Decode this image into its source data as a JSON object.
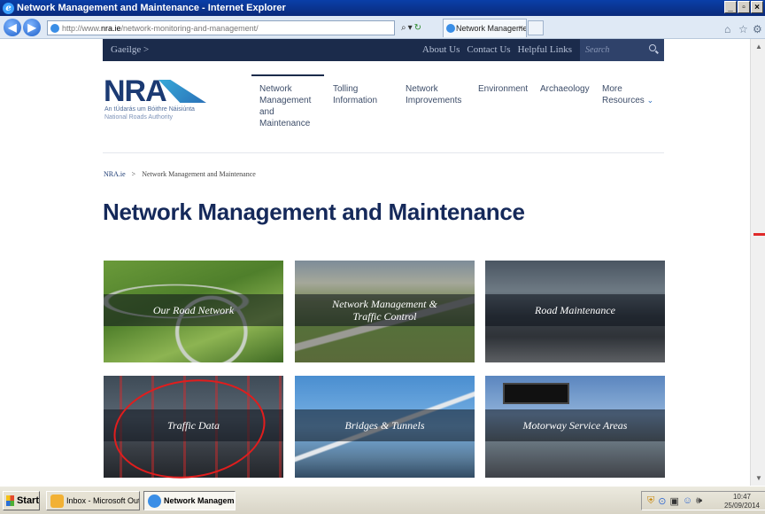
{
  "browser": {
    "window_title": "Network Management and Maintenance - Internet Explorer",
    "address_prefix": "http://www.",
    "address_domain": "nra.ie",
    "address_path": "/network-monitoring-and-management/",
    "tab_title": "Network Management and M...",
    "tab_close": "×"
  },
  "site": {
    "top_strip": {
      "gaeilge_link": "Gaeilge >",
      "about": "About Us",
      "contact": "Contact Us",
      "helpful": "Helpful Links",
      "search_placeholder": "Search"
    },
    "logo": {
      "text": "NRA",
      "irish_name": "An tÚdarás um Bóithre Náisiúnta",
      "english_name": "National Roads Authority"
    },
    "nav": [
      {
        "lines": [
          "Network",
          "Management",
          "and",
          "Maintenance"
        ],
        "active": true
      },
      {
        "lines": [
          "Tolling",
          "Information"
        ]
      },
      {
        "lines": [
          "Network",
          "Improvements"
        ]
      },
      {
        "lines": [
          "Environment"
        ]
      },
      {
        "lines": [
          "Archaeology"
        ]
      },
      {
        "lines": [
          "More",
          "Resources"
        ]
      }
    ],
    "breadcrumb": {
      "home": "NRA.ie",
      "separator": ">",
      "current": "Network Management and Maintenance"
    },
    "page_title": "Network Management and Maintenance",
    "tiles": [
      {
        "label": "Our Road Network"
      },
      {
        "label_line1": "Network Management &",
        "label_line2": "Traffic Control"
      },
      {
        "label": "Road Maintenance"
      },
      {
        "label": "Traffic Data"
      },
      {
        "label": "Bridges & Tunnels"
      },
      {
        "label": "Motorway Service Areas"
      }
    ]
  },
  "taskbar": {
    "start": "Start",
    "items": [
      {
        "label": "Inbox - Microsoft Out..."
      },
      {
        "label": "Network Managem..."
      }
    ],
    "time": "10:47",
    "date": "25/09/2014"
  },
  "colors": {
    "site_navy": "#1b2b4b",
    "title_blue": "#15295a",
    "annotation_red": "#e11d1d"
  }
}
